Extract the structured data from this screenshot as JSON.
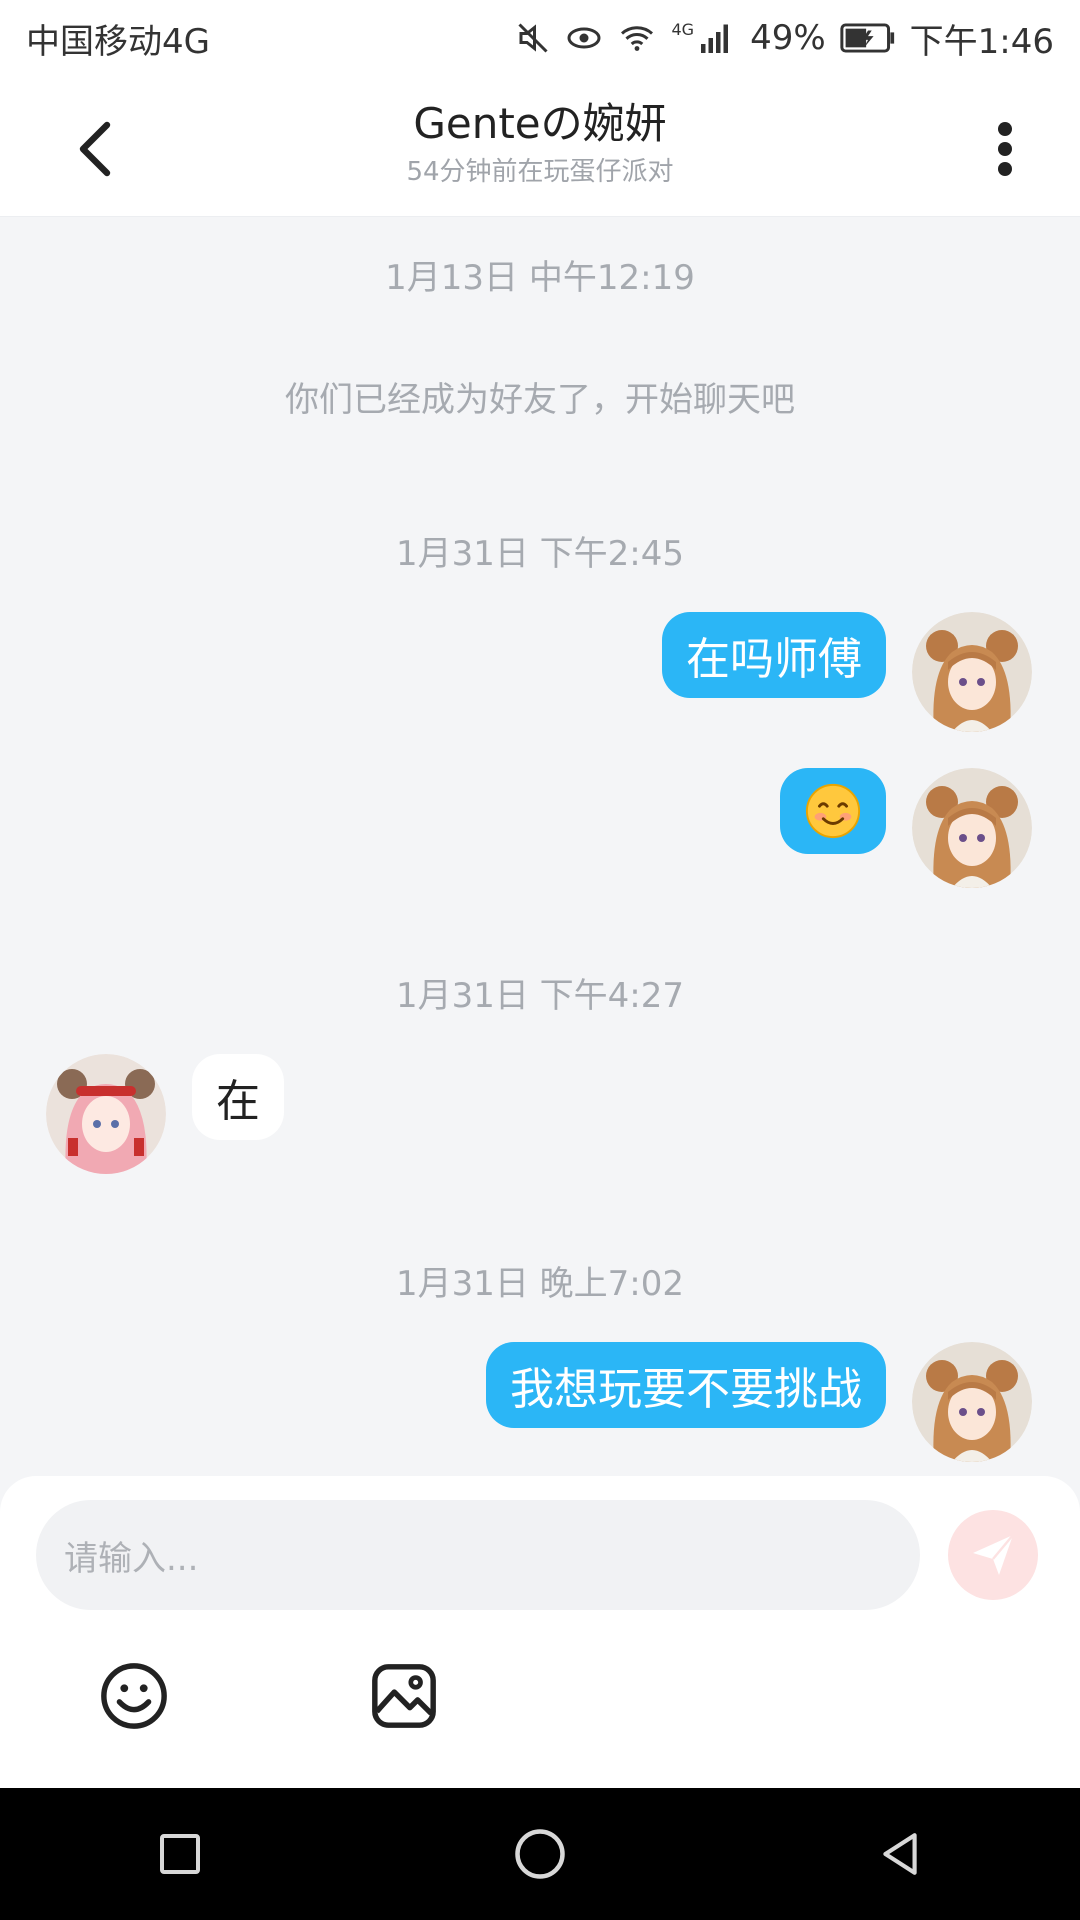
{
  "status_bar": {
    "carrier": "中国移动4G",
    "network": "4G",
    "battery": "49%",
    "time": "下午1:46"
  },
  "header": {
    "title": "Genteの婉妍",
    "subtitle": "54分钟前在玩蛋仔派对"
  },
  "chat": {
    "timestamps": [
      "1月13日 中午12:19",
      "1月31日 下午2:45",
      "1月31日 下午4:27",
      "1月31日 晚上7:02"
    ],
    "system_message": "你们已经成为好友了，开始聊天吧",
    "messages": [
      {
        "side": "out",
        "text": "在吗师傅"
      },
      {
        "side": "out",
        "text": "😊"
      },
      {
        "side": "in",
        "text": "在"
      },
      {
        "side": "out",
        "text": "我想玩要不要挑战"
      }
    ]
  },
  "composer": {
    "placeholder": "请输入..."
  },
  "colors": {
    "outgoing_bubble": "#2bb6f6",
    "send_button": "#fde2e2",
    "background": "#f4f5f7"
  },
  "icons": [
    "mute-icon",
    "eye-icon",
    "wifi-icon",
    "signal-icon",
    "battery-icon",
    "back-icon",
    "more-icon",
    "send-icon",
    "emoji-icon",
    "image-icon",
    "recent-apps-icon",
    "home-icon",
    "nav-back-icon"
  ]
}
